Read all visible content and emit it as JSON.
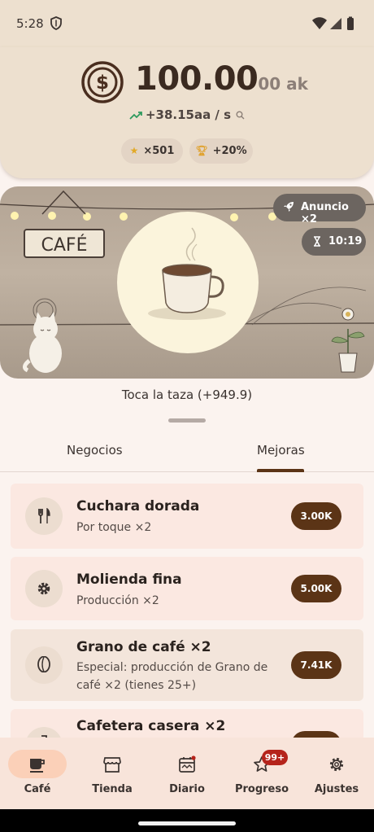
{
  "status_bar": {
    "time": "5:28"
  },
  "header": {
    "money_main": "100.00",
    "money_suffix": "00 ak",
    "rate": "+38.15aa / s",
    "chips": [
      {
        "icon": "star-icon",
        "label": "×501"
      },
      {
        "icon": "trophy-icon",
        "label": "+20%"
      }
    ]
  },
  "banner": {
    "sign_text": "CAFÉ",
    "ad_chip_label": "Anuncio ×2",
    "timer_label": "10:19"
  },
  "tap_hint": "Toca la taza  (+949.9)",
  "tabs": [
    {
      "label": "Negocios",
      "selected": false
    },
    {
      "label": "Mejoras",
      "selected": true
    }
  ],
  "upgrades": [
    {
      "icon": "fork-knife-icon",
      "title": "Cuchara dorada",
      "desc": "Por toque ×2",
      "price": "3.00K"
    },
    {
      "icon": "gear-icon",
      "title": "Molienda fina",
      "desc": "Producción ×2",
      "price": "5.00K"
    },
    {
      "icon": "coffee-bean-icon",
      "title": "Grano de café ×2",
      "desc": "Especial: producción de Grano de café ×2 (tienes 25+)",
      "price": "7.41K"
    },
    {
      "icon": "coffee-maker-icon",
      "title": "Cafetera casera ×2",
      "desc": "",
      "price": ""
    }
  ],
  "bottom_nav": [
    {
      "icon": "coffee-cup-icon",
      "label": "Café",
      "selected": true
    },
    {
      "icon": "store-icon",
      "label": "Tienda",
      "selected": false
    },
    {
      "icon": "calendar-icon",
      "label": "Diario",
      "selected": false
    },
    {
      "icon": "star-outline-icon",
      "label": "Progreso",
      "selected": false,
      "badge": "99+"
    },
    {
      "icon": "settings-icon",
      "label": "Ajustes",
      "selected": false
    }
  ],
  "colors": {
    "header_bg": "#ede0cf",
    "accent_brown": "#5b3416",
    "nav_selected_pill": "#fbd0b8",
    "badge_red": "#b5231b"
  }
}
